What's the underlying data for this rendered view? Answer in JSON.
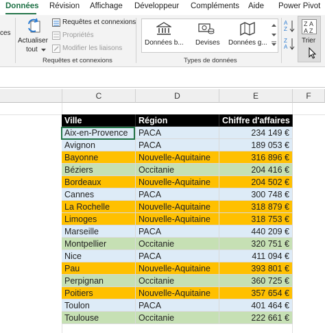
{
  "tabs": {
    "donnees": "Données",
    "revision": "Révision",
    "affichage": "Affichage",
    "developpeur": "Développeur",
    "complements": "Compléments",
    "aide": "Aide",
    "power_pivot": "Power Pivot"
  },
  "ribbon": {
    "left_partial": "ces",
    "actualiser": "Actualiser",
    "tout": "tout",
    "requetes_connexions": "Requêtes et connexions",
    "proprietes": "Propriétés",
    "modifier_liaisons": "Modifier les liaisons",
    "group_requetes": "Requêtes et connexions",
    "donnees_b": "Données b...",
    "devises": "Devises",
    "donnees_g": "Données g...",
    "group_types": "Types de données",
    "trier": "Trier"
  },
  "columns": {
    "c": "C",
    "d": "D",
    "e": "E",
    "f": "F"
  },
  "table": {
    "headers": [
      "Ville",
      "Région",
      "Chiffre d'affaires"
    ],
    "rows": [
      {
        "ville": "Aix-en-Provence",
        "region": "PACA",
        "ca": "234 149 €"
      },
      {
        "ville": "Avignon",
        "region": "PACA",
        "ca": "189 053 €"
      },
      {
        "ville": "Bayonne",
        "region": "Nouvelle-Aquitaine",
        "ca": "316 896 €"
      },
      {
        "ville": "Béziers",
        "region": "Occitanie",
        "ca": "204 416 €"
      },
      {
        "ville": "Bordeaux",
        "region": "Nouvelle-Aquitaine",
        "ca": "204 502 €"
      },
      {
        "ville": "Cannes",
        "region": "PACA",
        "ca": "300 748 €"
      },
      {
        "ville": "La Rochelle",
        "region": "Nouvelle-Aquitaine",
        "ca": "318 879 €"
      },
      {
        "ville": "Limoges",
        "region": "Nouvelle-Aquitaine",
        "ca": "318 753 €"
      },
      {
        "ville": "Marseille",
        "region": "PACA",
        "ca": "440 209 €"
      },
      {
        "ville": "Montpellier",
        "region": "Occitanie",
        "ca": "320 751 €"
      },
      {
        "ville": "Nice",
        "region": "PACA",
        "ca": "411 094 €"
      },
      {
        "ville": "Pau",
        "region": "Nouvelle-Aquitaine",
        "ca": "393 801 €"
      },
      {
        "ville": "Perpignan",
        "region": "Occitanie",
        "ca": "360 725 €"
      },
      {
        "ville": "Poitiers",
        "region": "Nouvelle-Aquitaine",
        "ca": "357 654 €"
      },
      {
        "ville": "Toulon",
        "region": "PACA",
        "ca": "401 464 €"
      },
      {
        "ville": "Toulouse",
        "region": "Occitanie",
        "ca": "222 661 €"
      }
    ]
  },
  "colors": {
    "accent": "#1e7145",
    "paca": "#ddebf7",
    "nouvelle_aquitaine": "#ffc000",
    "occitanie": "#c6e0b4",
    "header": "#000000"
  }
}
